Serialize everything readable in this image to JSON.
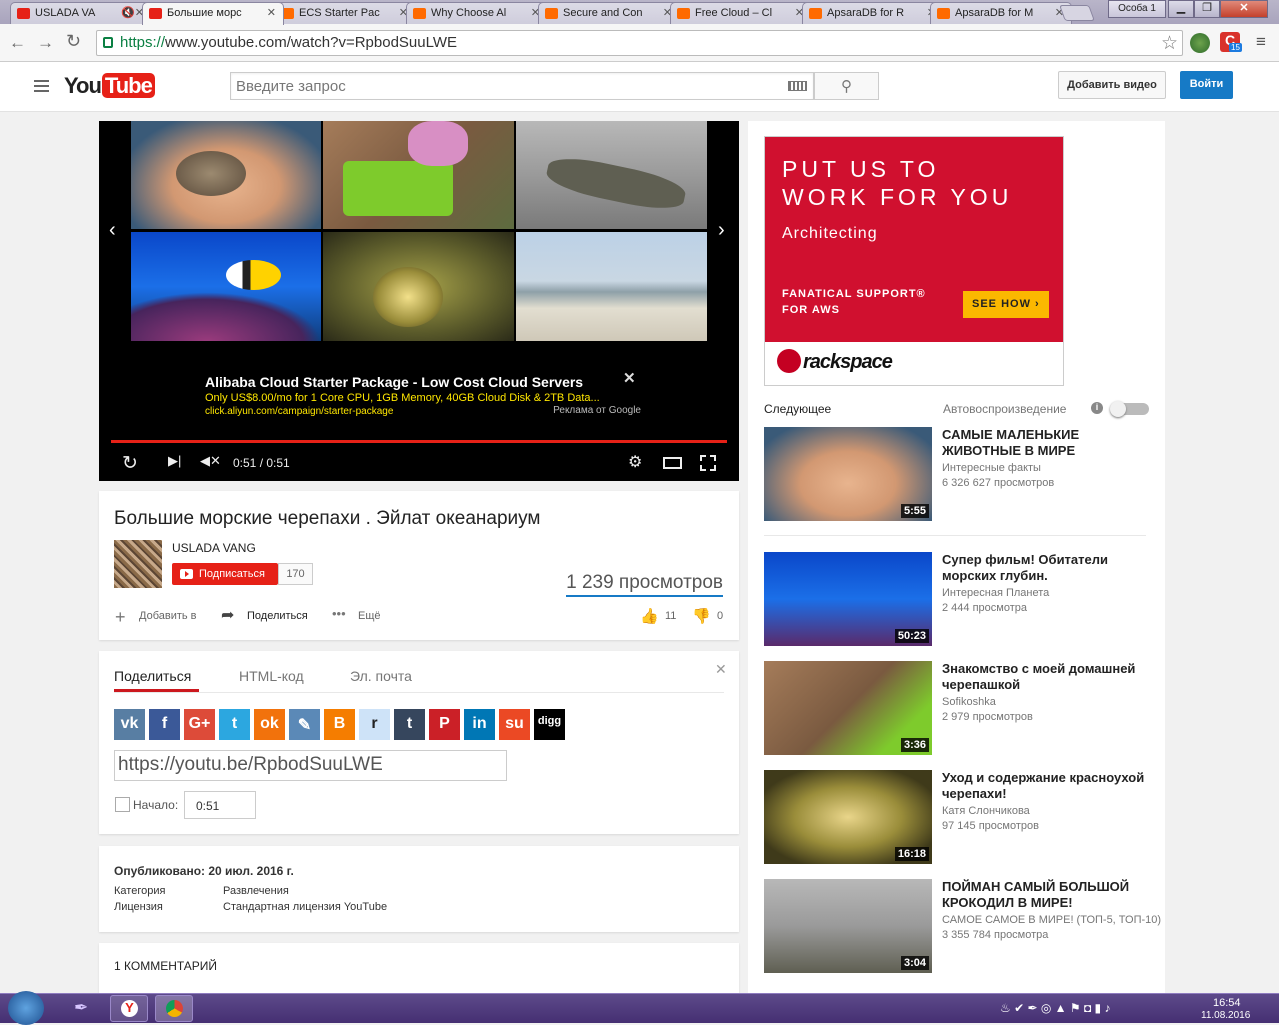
{
  "browser": {
    "tabs": [
      {
        "title": "USLADA VA",
        "favicon_color": "#e62117"
      },
      {
        "title": "Большие морс",
        "favicon_color": "#e62117",
        "active": true
      },
      {
        "title": "ECS Starter Pac",
        "favicon_color": "#ff6a00"
      },
      {
        "title": "Why Choose Al",
        "favicon_color": "#ff6a00"
      },
      {
        "title": "Secure and Con",
        "favicon_color": "#ff6a00"
      },
      {
        "title": "Free Cloud – Cl",
        "favicon_color": "#ff6a00"
      },
      {
        "title": "ApsaraDB for R",
        "favicon_color": "#ff6a00"
      },
      {
        "title": "ApsaraDB for M",
        "favicon_color": "#ff6a00"
      }
    ],
    "profile_label": "Особа 1",
    "url_scheme": "https://",
    "url_rest": "www.youtube.com/watch?v=RpbodSuuLWE",
    "ext_badge": "15"
  },
  "yt_header": {
    "logo_you": "You",
    "logo_tube": "Tube",
    "search_placeholder": "Введите запрос",
    "upload_label": "Добавить видео",
    "signin_label": "Войти"
  },
  "player": {
    "ad_title": "Alibaba Cloud Starter Package - Low Cost Cloud Servers",
    "ad_text": "Only US$8.00/mo for 1 Core CPU, 1GB Memory, 40GB Cloud Disk & 2TB Data...",
    "ad_link": "click.aliyun.com/campaign/starter-package",
    "ad_by": "Реклама от Google",
    "time": "0:51 / 0:51",
    "progress": 1.0
  },
  "video": {
    "title": "Большие морские черепахи . Эйлат океанариум",
    "channel": "USLADA VANG",
    "subscribe_label": "Подписаться",
    "sub_count": "170",
    "views": "1 239 просмотров",
    "add_to": "Добавить в",
    "share": "Поделиться",
    "more": "Ещё",
    "likes": "11",
    "dislikes": "0"
  },
  "share": {
    "tabs": [
      "Поделиться",
      "HTML-код",
      "Эл. почта"
    ],
    "link": "https://youtu.be/RpbodSuuLWE",
    "start_label": "Начало:",
    "start_time": "0:51",
    "networks": [
      {
        "name": "vk",
        "label": "vk",
        "color": "#587ea3"
      },
      {
        "name": "facebook",
        "label": "f",
        "color": "#3b5998"
      },
      {
        "name": "google-plus",
        "label": "G+",
        "color": "#dd4b39"
      },
      {
        "name": "twitter",
        "label": "t",
        "color": "#2ca7e0"
      },
      {
        "name": "odnoklassniki",
        "label": "ok",
        "color": "#f2720c"
      },
      {
        "name": "livejournal",
        "label": "✎",
        "color": "#5b89b7"
      },
      {
        "name": "blogger",
        "label": "B",
        "color": "#f57d00"
      },
      {
        "name": "reddit",
        "label": "r",
        "color": "#cee3f8"
      },
      {
        "name": "tumblr",
        "label": "t",
        "color": "#36465d"
      },
      {
        "name": "pinterest",
        "label": "P",
        "color": "#cb2027"
      },
      {
        "name": "linkedin",
        "label": "in",
        "color": "#0077b5"
      },
      {
        "name": "stumbleupon",
        "label": "su",
        "color": "#eb4924"
      },
      {
        "name": "digg",
        "label": "digg",
        "color": "#000000"
      }
    ]
  },
  "details": {
    "published": "Опубликовано: 20 июл. 2016 г.",
    "category_label": "Категория",
    "category_value": "Развлечения",
    "license_label": "Лицензия",
    "license_value": "Стандартная лицензия YouTube"
  },
  "comments": {
    "header": "1 КОММЕНТАРИЙ"
  },
  "sidebar_ad": {
    "line1": "PUT US TO",
    "line2": "WORK FOR YOU",
    "sub": "Architecting",
    "support1": "FANATICAL SUPPORT®",
    "support2": "FOR AWS",
    "cta": "SEE HOW",
    "brand": "rackspace"
  },
  "upnext": {
    "heading": "Следующее",
    "autoplay_label": "Автовоспроизведение",
    "items": [
      {
        "title": "САМЫЕ МАЛЕНЬКИЕ ЖИВОТНЫЕ В МИРЕ",
        "channel": "Интересные факты",
        "views": "6 326 627 просмотров",
        "duration": "5:55"
      },
      {
        "title": "Супер фильм! Обитатели морских глубин.",
        "channel": "Интересная Планета",
        "views": "2 444 просмотра",
        "duration": "50:23"
      },
      {
        "title": "Знакомство с моей домашней черепашкой",
        "channel": "Sofikoshka",
        "views": "2 979 просмотров",
        "duration": "3:36"
      },
      {
        "title": "Уход и содержание красноухой черепахи!",
        "channel": "Катя Слончикова",
        "views": "97 145 просмотров",
        "duration": "16:18"
      },
      {
        "title": "ПОЙМАН САМЫЙ БОЛЬШОЙ КРОКОДИЛ В МИРЕ!",
        "channel": "САМОЕ САМОЕ В МИРЕ! (ТОП-5, ТОП-10)",
        "views": "3 355 784 просмотра",
        "duration": "3:04"
      }
    ]
  },
  "taskbar": {
    "time": "16:54",
    "date": "11.08.2016"
  }
}
